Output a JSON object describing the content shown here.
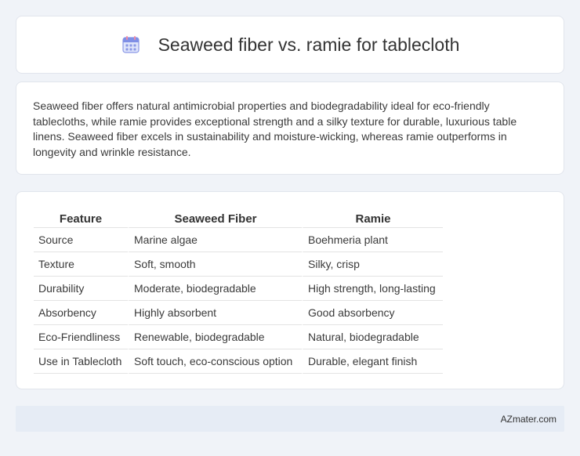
{
  "header": {
    "icon": "calendar-icon",
    "title": "Seaweed fiber vs. ramie for tablecloth"
  },
  "summary": {
    "text": "Seaweed fiber offers natural antimicrobial properties and biodegradability ideal for eco-friendly tablecloths, while ramie provides exceptional strength and a silky texture for durable, luxurious table linens. Seaweed fiber excels in sustainability and moisture-wicking, whereas ramie outperforms in longevity and wrinkle resistance."
  },
  "table": {
    "headers": [
      "Feature",
      "Seaweed Fiber",
      "Ramie"
    ],
    "rows": [
      [
        "Source",
        "Marine algae",
        "Boehmeria plant"
      ],
      [
        "Texture",
        "Soft, smooth",
        "Silky, crisp"
      ],
      [
        "Durability",
        "Moderate, biodegradable",
        "High strength, long-lasting"
      ],
      [
        "Absorbency",
        "Highly absorbent",
        "Good absorbency"
      ],
      [
        "Eco-Friendliness",
        "Renewable, biodegradable",
        "Natural, biodegradable"
      ],
      [
        "Use in Tablecloth",
        "Soft touch, eco-conscious option",
        "Durable, elegant finish"
      ]
    ]
  },
  "footer": {
    "brand": "AZmater.com"
  },
  "colors": {
    "background": "#f0f3f8",
    "card": "#ffffff",
    "footer": "#e6ecf5",
    "icon_primary": "#6f7fe0",
    "icon_accent": "#f08aa6"
  }
}
